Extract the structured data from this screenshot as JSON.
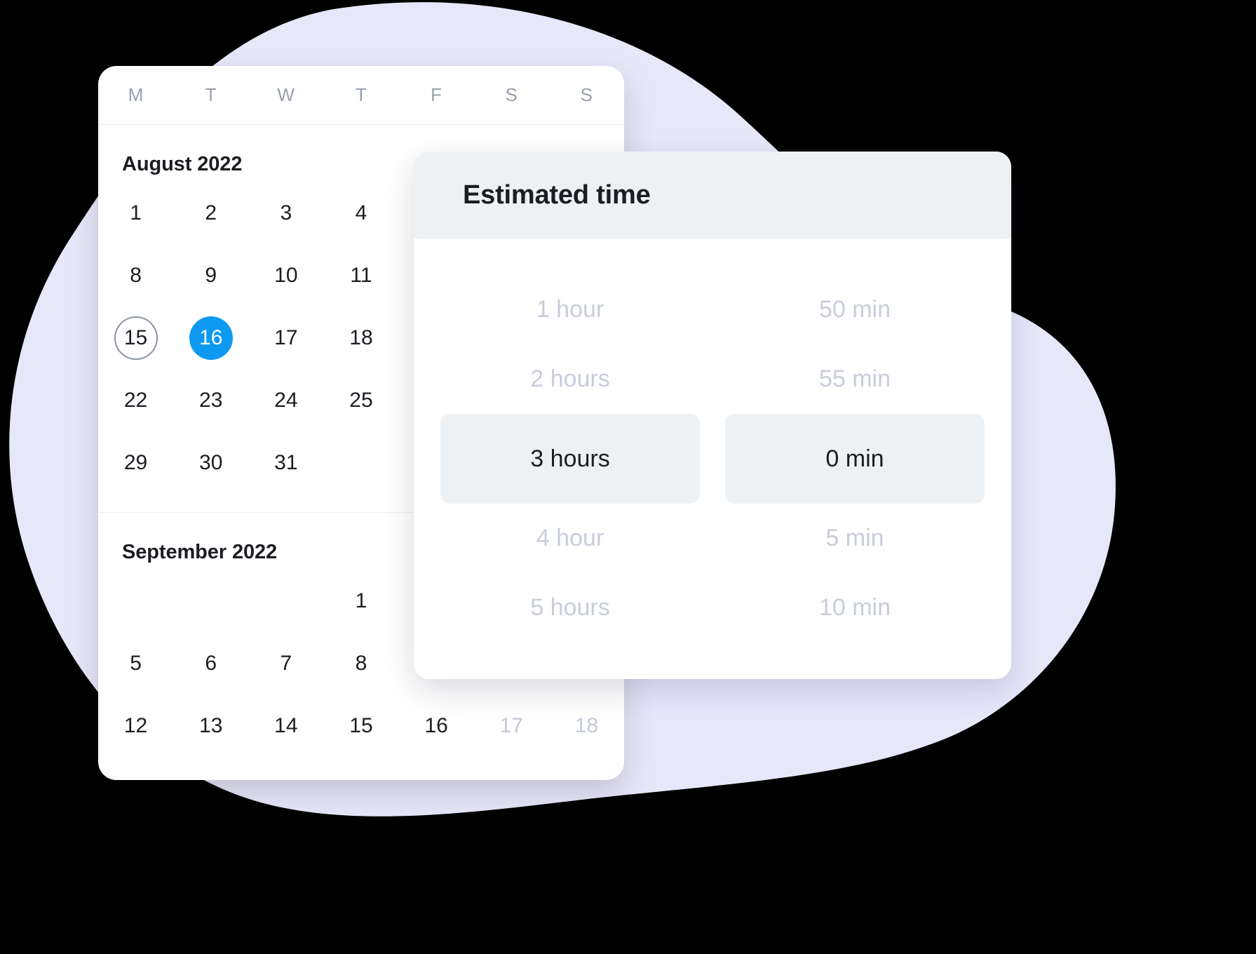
{
  "background": {
    "canvas_color": "#000000",
    "blob_color": "#E7E7FA"
  },
  "calendar": {
    "weekdays": [
      "M",
      "T",
      "W",
      "T",
      "F",
      "S",
      "S"
    ],
    "months": [
      {
        "title": "August 2022",
        "lead_blank": 0,
        "weeks": [
          [
            {
              "label": "1",
              "state": "normal"
            },
            {
              "label": "2",
              "state": "normal"
            },
            {
              "label": "3",
              "state": "normal"
            },
            {
              "label": "4",
              "state": "normal"
            },
            {
              "label": "",
              "state": "empty"
            },
            {
              "label": "",
              "state": "empty"
            },
            {
              "label": "",
              "state": "empty"
            }
          ],
          [
            {
              "label": "8",
              "state": "normal"
            },
            {
              "label": "9",
              "state": "normal"
            },
            {
              "label": "10",
              "state": "normal"
            },
            {
              "label": "11",
              "state": "normal"
            },
            {
              "label": "",
              "state": "empty"
            },
            {
              "label": "",
              "state": "empty"
            },
            {
              "label": "",
              "state": "empty"
            }
          ],
          [
            {
              "label": "15",
              "state": "today"
            },
            {
              "label": "16",
              "state": "selected"
            },
            {
              "label": "17",
              "state": "normal"
            },
            {
              "label": "18",
              "state": "normal"
            },
            {
              "label": "",
              "state": "empty"
            },
            {
              "label": "",
              "state": "empty"
            },
            {
              "label": "",
              "state": "empty"
            }
          ],
          [
            {
              "label": "22",
              "state": "normal"
            },
            {
              "label": "23",
              "state": "normal"
            },
            {
              "label": "24",
              "state": "normal"
            },
            {
              "label": "25",
              "state": "normal"
            },
            {
              "label": "",
              "state": "empty"
            },
            {
              "label": "",
              "state": "empty"
            },
            {
              "label": "",
              "state": "empty"
            }
          ],
          [
            {
              "label": "29",
              "state": "normal"
            },
            {
              "label": "30",
              "state": "normal"
            },
            {
              "label": "31",
              "state": "normal"
            },
            {
              "label": "",
              "state": "empty"
            },
            {
              "label": "",
              "state": "empty"
            },
            {
              "label": "",
              "state": "empty"
            },
            {
              "label": "",
              "state": "empty"
            }
          ]
        ]
      },
      {
        "title": "September 2022",
        "lead_blank": 3,
        "weeks": [
          [
            {
              "label": "",
              "state": "empty"
            },
            {
              "label": "",
              "state": "empty"
            },
            {
              "label": "",
              "state": "empty"
            },
            {
              "label": "1",
              "state": "normal"
            },
            {
              "label": "",
              "state": "empty"
            },
            {
              "label": "",
              "state": "empty"
            },
            {
              "label": "",
              "state": "empty"
            }
          ],
          [
            {
              "label": "5",
              "state": "normal"
            },
            {
              "label": "6",
              "state": "normal"
            },
            {
              "label": "7",
              "state": "normal"
            },
            {
              "label": "8",
              "state": "normal"
            },
            {
              "label": "",
              "state": "empty"
            },
            {
              "label": "",
              "state": "empty"
            },
            {
              "label": "",
              "state": "empty"
            }
          ],
          [
            {
              "label": "12",
              "state": "normal"
            },
            {
              "label": "13",
              "state": "normal"
            },
            {
              "label": "14",
              "state": "normal"
            },
            {
              "label": "15",
              "state": "normal"
            },
            {
              "label": "16",
              "state": "normal"
            },
            {
              "label": "17",
              "state": "muted"
            },
            {
              "label": "18",
              "state": "muted"
            }
          ]
        ]
      }
    ],
    "selected_date_color": "#0D99F2",
    "today_outline_color": "#8B93A4"
  },
  "time_picker": {
    "title": "Estimated time",
    "header_background": "#EDF1F4",
    "selected_pill_background": "#EDF1F4",
    "hours": {
      "options": [
        "1 hour",
        "2 hours",
        "3 hours",
        "4 hour",
        "5 hours"
      ],
      "selected": "3 hours"
    },
    "minutes": {
      "options": [
        "50 min",
        "55 min",
        "0 min",
        "5 min",
        "10 min"
      ],
      "selected": "0 min"
    }
  }
}
